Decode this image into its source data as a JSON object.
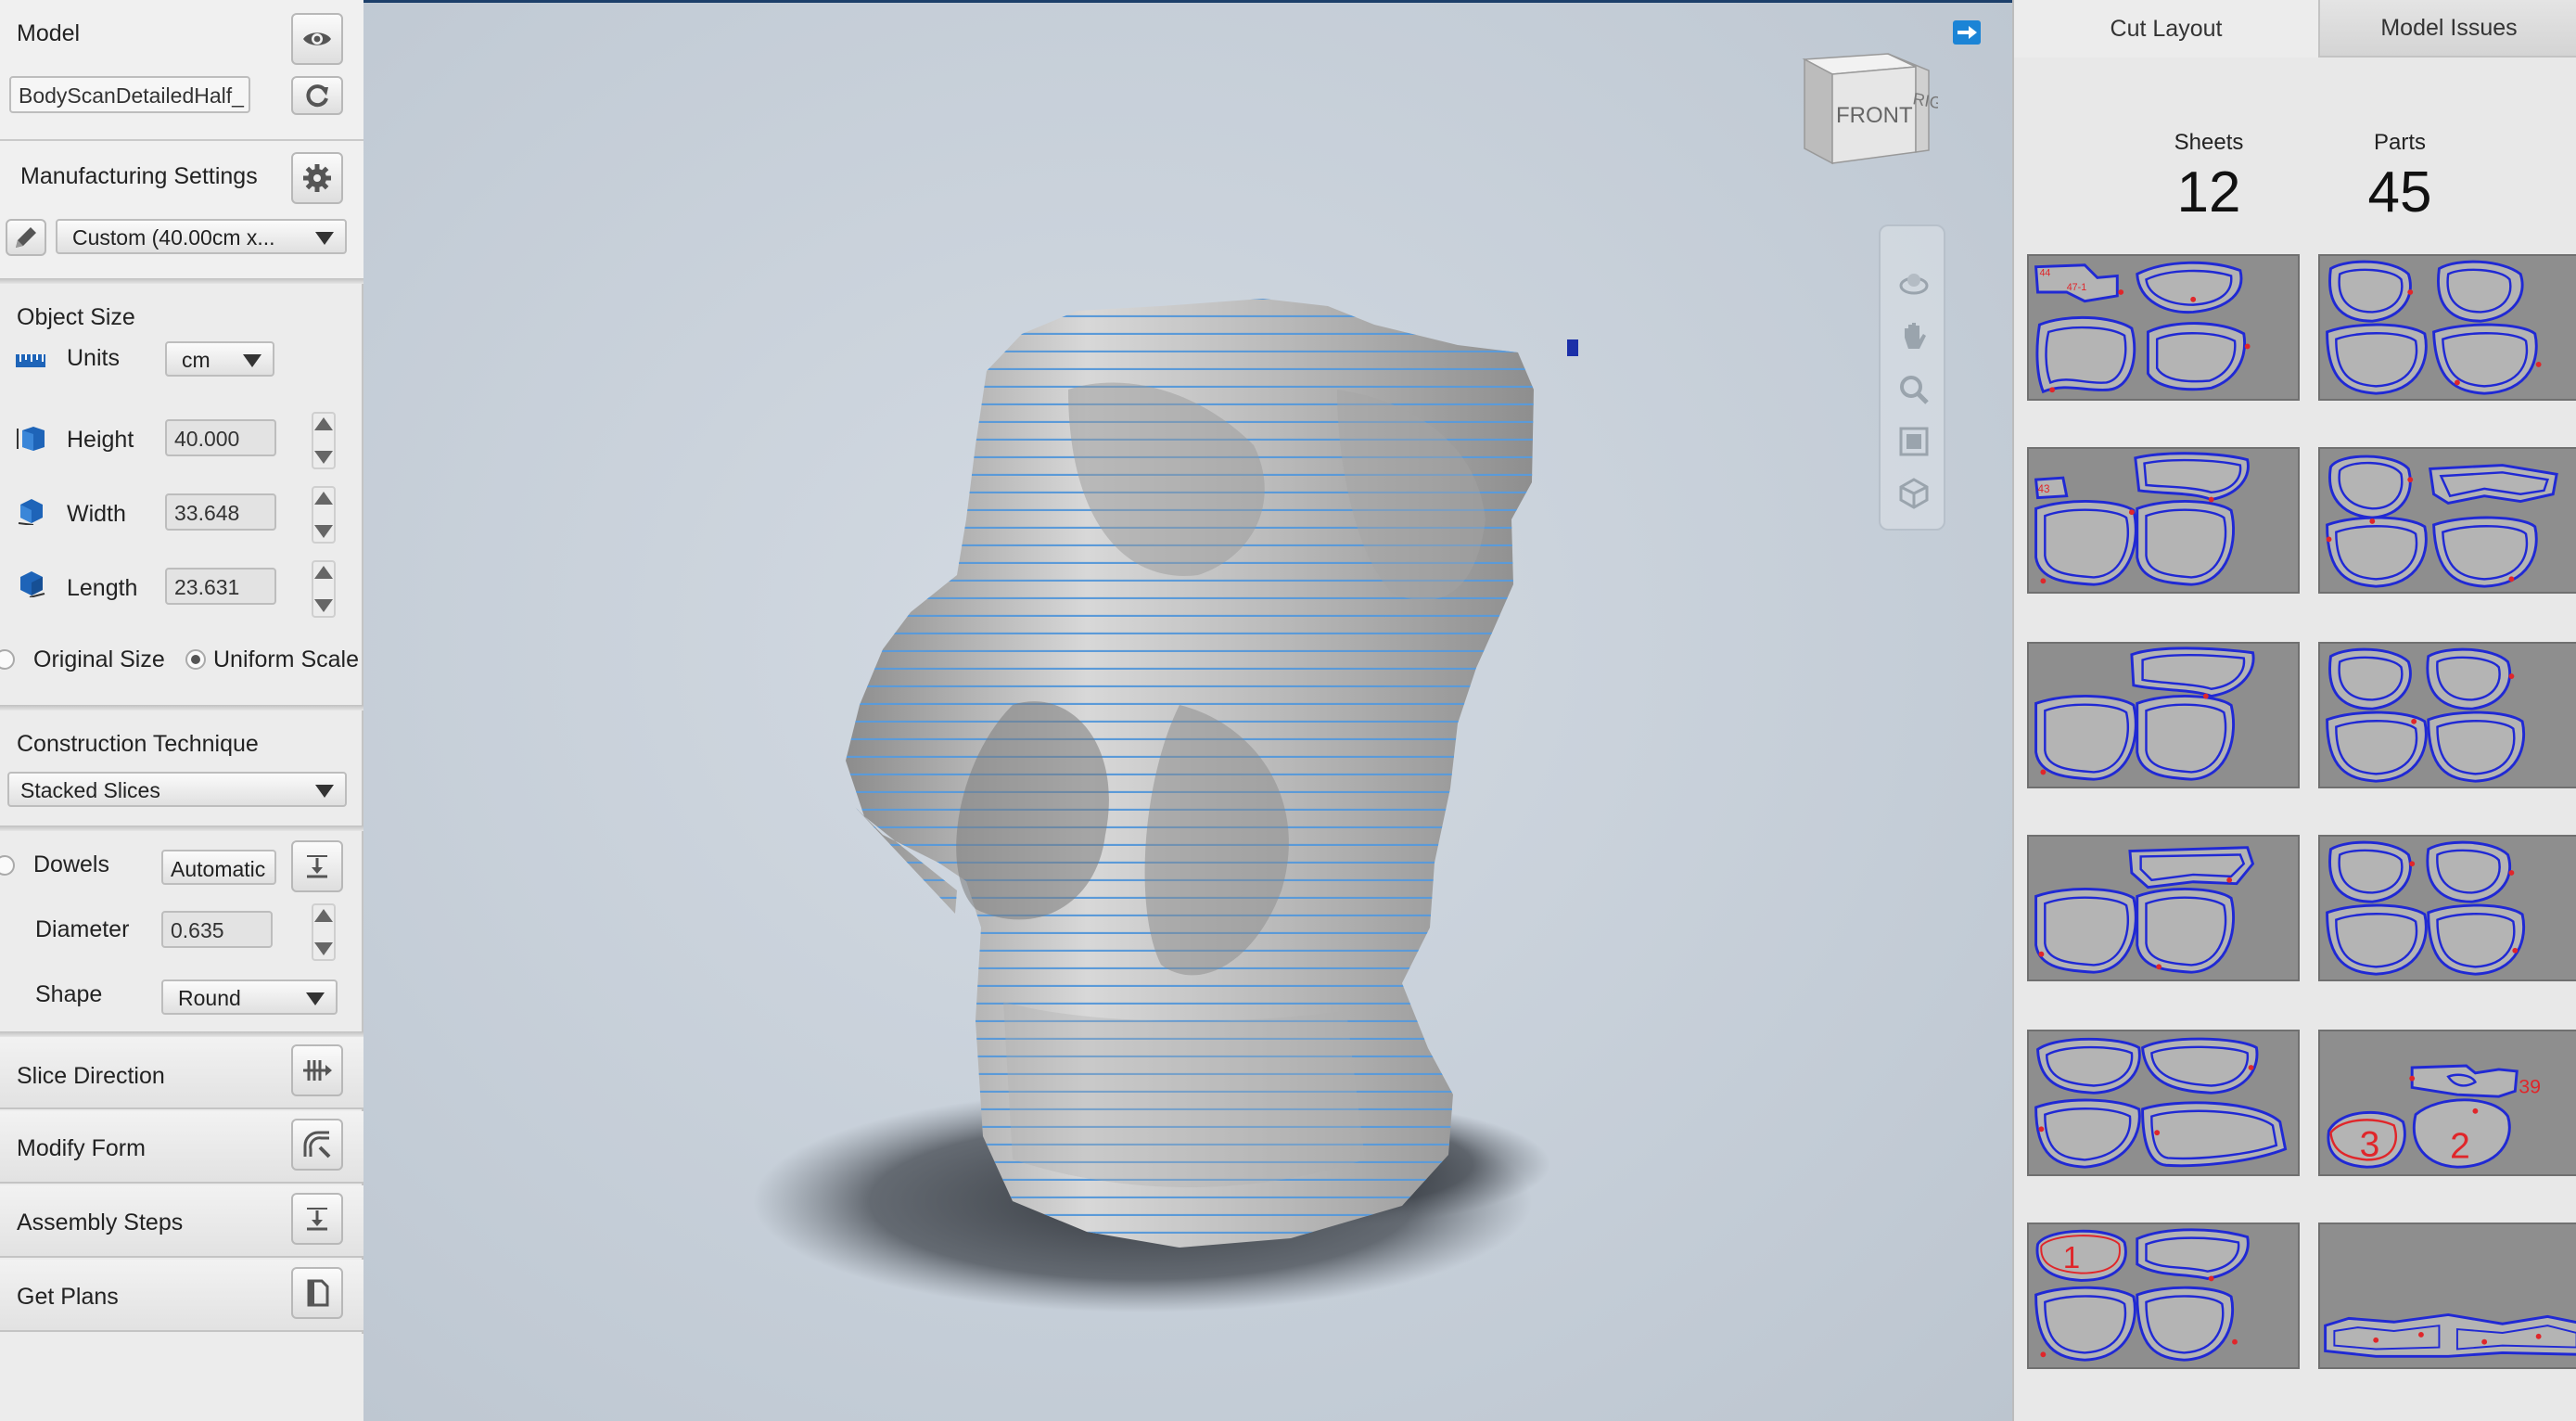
{
  "left_panel": {
    "model_label": "Model",
    "model_file": "BodyScanDetailedHalf_",
    "manufacturing_label": "Manufacturing Settings",
    "manufacturing_value": "Custom (40.00cm x...",
    "object_size_label": "Object Size",
    "units_label": "Units",
    "units_value": "cm",
    "height_label": "Height",
    "height_value": "40.000",
    "width_label": "Width",
    "width_value": "33.648",
    "length_label": "Length",
    "length_value": "23.631",
    "original_size_label": "Original Size",
    "uniform_scale_label": "Uniform Scale",
    "construction_label": "Construction Technique",
    "construction_value": "Stacked Slices",
    "dowels_label": "Dowels",
    "dowels_value": "Automatic",
    "diameter_label": "Diameter",
    "diameter_value": "0.635",
    "shape_label": "Shape",
    "shape_value": "Round",
    "slice_direction_label": "Slice Direction",
    "modify_form_label": "Modify Form",
    "assembly_steps_label": "Assembly Steps",
    "get_plans_label": "Get Plans"
  },
  "viewport": {
    "navcube_front": "FRONT",
    "navcube_right": "RIGHT"
  },
  "right_panel": {
    "tab_cut_layout": "Cut Layout",
    "tab_model_issues": "Model Issues",
    "sheets_label": "Sheets",
    "sheets_value": "12",
    "parts_label": "Parts",
    "parts_value": "45",
    "sheet_labels": {
      "s9_a": "3",
      "s9_b": "2",
      "s9_c": "39",
      "s11_a": "1",
      "s1_a": "44",
      "s1_b": "47-1",
      "s3_a": "43"
    }
  },
  "colors": {
    "outline_blue": "#1f2bd6",
    "mark_red": "#e0262a",
    "sheet_grey": "#8e8e8e",
    "accent_blue": "#1b84d6"
  }
}
